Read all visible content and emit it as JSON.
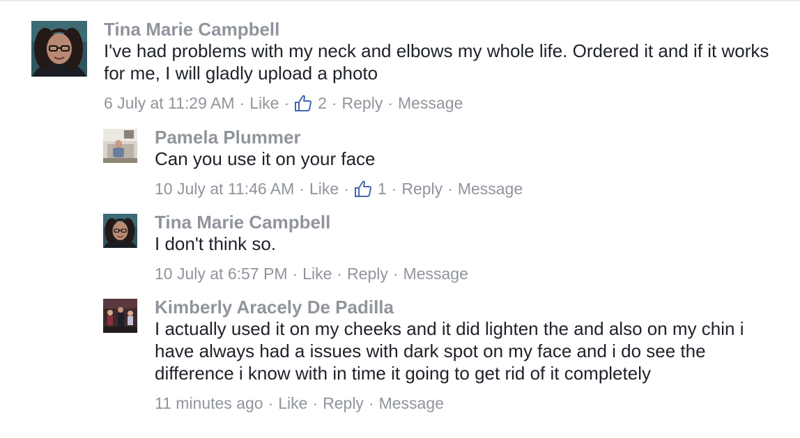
{
  "comments": [
    {
      "author": "Tina Marie Campbell",
      "text": "I've had problems with my neck and elbows my whole life. Ordered it and if it works for me, I will gladly upload a photo",
      "time": "6 July at 11:29 AM",
      "like_label": "Like",
      "likes": "2",
      "reply_label": "Reply",
      "message_label": "Message",
      "avatar_icon": "avatar-woman-glasses"
    },
    {
      "author": "Pamela Plummer",
      "text": "Can you use it on your face",
      "time": "10 July at 11:46 AM",
      "like_label": "Like",
      "likes": "1",
      "reply_label": "Reply",
      "message_label": "Message",
      "avatar_icon": "avatar-seated-person"
    },
    {
      "author": "Tina Marie Campbell",
      "text": "I don't think so.",
      "time": "10 July at 6:57 PM",
      "like_label": "Like",
      "reply_label": "Reply",
      "message_label": "Message",
      "avatar_icon": "avatar-woman-glasses"
    },
    {
      "author": "Kimberly Aracely De Padilla",
      "text": "I actually used it on my cheeks and it did lighten the and also on my chin i have always had a issues with dark spot on my face and i do see the difference i know with in time it going to get rid of it completely",
      "time": "11 minutes ago",
      "like_label": "Like",
      "reply_label": "Reply",
      "message_label": "Message",
      "avatar_icon": "avatar-group-photo"
    }
  ],
  "colors": {
    "author": "#1d2129",
    "meta": "#90949c",
    "like_icon": "#4267b2"
  }
}
